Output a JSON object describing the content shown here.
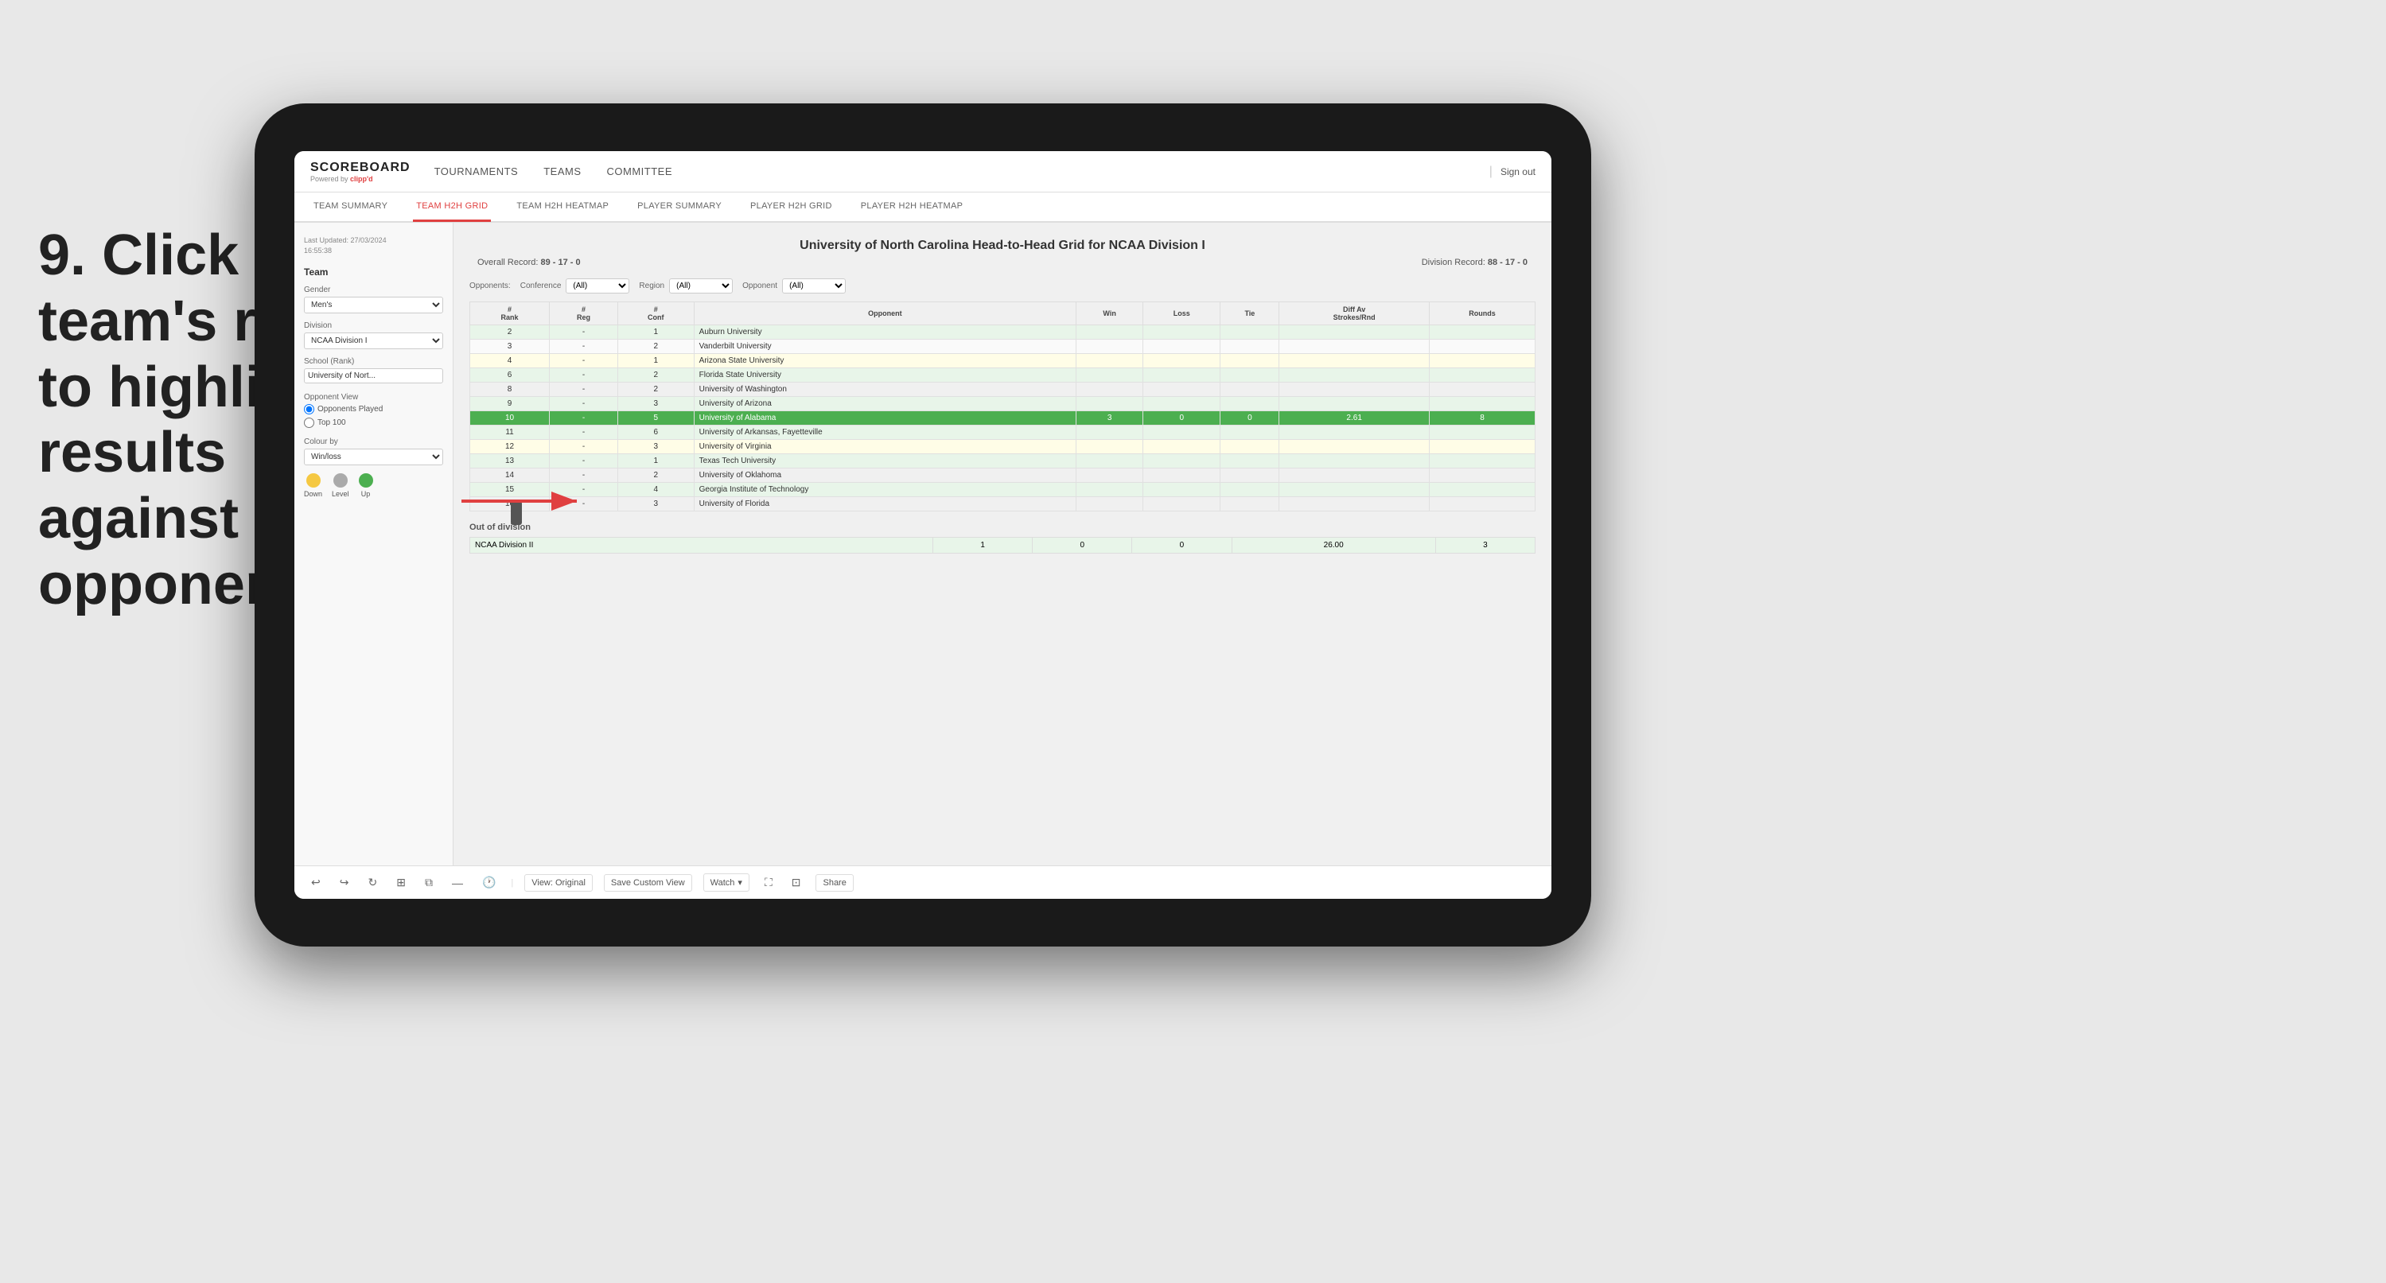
{
  "instruction": {
    "step": "9.",
    "text": "Click on a team's row to highlight results against that opponent"
  },
  "nav": {
    "logo": "SCOREBOARD",
    "powered_by": "Powered by",
    "brand": "clipp'd",
    "items": [
      "TOURNAMENTS",
      "TEAMS",
      "COMMITTEE"
    ],
    "sign_out": "Sign out"
  },
  "sub_nav": {
    "items": [
      "TEAM SUMMARY",
      "TEAM H2H GRID",
      "TEAM H2H HEATMAP",
      "PLAYER SUMMARY",
      "PLAYER H2H GRID",
      "PLAYER H2H HEATMAP"
    ],
    "active": "TEAM H2H GRID"
  },
  "sidebar": {
    "timestamp_label": "Last Updated: 27/03/2024",
    "timestamp_value": "16:55:38",
    "team_label": "Team",
    "gender_label": "Gender",
    "gender_value": "Men's",
    "division_label": "Division",
    "division_value": "NCAA Division I",
    "school_label": "School (Rank)",
    "school_value": "University of Nort...",
    "opponent_view_label": "Opponent View",
    "radio_opponents_played": "Opponents Played",
    "radio_top100": "Top 100",
    "colour_by_label": "Colour by",
    "colour_by_value": "Win/loss",
    "legend": [
      {
        "label": "Down",
        "color": "#f5c842"
      },
      {
        "label": "Level",
        "color": "#aaaaaa"
      },
      {
        "label": "Up",
        "color": "#4caf50"
      }
    ]
  },
  "grid": {
    "title": "University of North Carolina Head-to-Head Grid for NCAA Division I",
    "overall_record_label": "Overall Record:",
    "overall_record": "89 - 17 - 0",
    "division_record_label": "Division Record:",
    "division_record": "88 - 17 - 0",
    "filters": {
      "opponents_label": "Opponents:",
      "conference_label": "Conference",
      "conference_value": "(All)",
      "region_label": "Region",
      "region_value": "(All)",
      "opponent_label": "Opponent",
      "opponent_value": "(All)"
    },
    "columns": [
      "#\nRank",
      "#\nReg",
      "#\nConf",
      "Opponent",
      "Win",
      "Loss",
      "Tie",
      "Diff Av\nStrokes/Rnd",
      "Rounds"
    ],
    "rows": [
      {
        "rank": "2",
        "reg": "-",
        "conf": "1",
        "opponent": "Auburn University",
        "win": "",
        "loss": "",
        "tie": "",
        "diff": "",
        "rounds": "",
        "style": "light-green"
      },
      {
        "rank": "3",
        "reg": "-",
        "conf": "2",
        "opponent": "Vanderbilt University",
        "win": "",
        "loss": "",
        "tie": "",
        "diff": "",
        "rounds": "",
        "style": "normal"
      },
      {
        "rank": "4",
        "reg": "-",
        "conf": "1",
        "opponent": "Arizona State University",
        "win": "",
        "loss": "",
        "tie": "",
        "diff": "",
        "rounds": "",
        "style": "light-yellow"
      },
      {
        "rank": "6",
        "reg": "-",
        "conf": "2",
        "opponent": "Florida State University",
        "win": "",
        "loss": "",
        "tie": "",
        "diff": "",
        "rounds": "",
        "style": "light-green"
      },
      {
        "rank": "8",
        "reg": "-",
        "conf": "2",
        "opponent": "University of Washington",
        "win": "",
        "loss": "",
        "tie": "",
        "diff": "",
        "rounds": "",
        "style": "normal"
      },
      {
        "rank": "9",
        "reg": "-",
        "conf": "3",
        "opponent": "University of Arizona",
        "win": "",
        "loss": "",
        "tie": "",
        "diff": "",
        "rounds": "",
        "style": "light-green"
      },
      {
        "rank": "10",
        "reg": "-",
        "conf": "5",
        "opponent": "University of Alabama",
        "win": "3",
        "loss": "0",
        "tie": "0",
        "diff": "2.61",
        "rounds": "8",
        "style": "highlighted"
      },
      {
        "rank": "11",
        "reg": "-",
        "conf": "6",
        "opponent": "University of Arkansas, Fayetteville",
        "win": "",
        "loss": "",
        "tie": "",
        "diff": "",
        "rounds": "",
        "style": "light-green"
      },
      {
        "rank": "12",
        "reg": "-",
        "conf": "3",
        "opponent": "University of Virginia",
        "win": "",
        "loss": "",
        "tie": "",
        "diff": "",
        "rounds": "",
        "style": "light-yellow"
      },
      {
        "rank": "13",
        "reg": "-",
        "conf": "1",
        "opponent": "Texas Tech University",
        "win": "",
        "loss": "",
        "tie": "",
        "diff": "",
        "rounds": "",
        "style": "light-green"
      },
      {
        "rank": "14",
        "reg": "-",
        "conf": "2",
        "opponent": "University of Oklahoma",
        "win": "",
        "loss": "",
        "tie": "",
        "diff": "",
        "rounds": "",
        "style": "normal"
      },
      {
        "rank": "15",
        "reg": "-",
        "conf": "4",
        "opponent": "Georgia Institute of Technology",
        "win": "",
        "loss": "",
        "tie": "",
        "diff": "",
        "rounds": "",
        "style": "light-green"
      },
      {
        "rank": "16",
        "reg": "-",
        "conf": "3",
        "opponent": "University of Florida",
        "win": "",
        "loss": "",
        "tie": "",
        "diff": "",
        "rounds": "",
        "style": "normal"
      }
    ],
    "out_of_division_label": "Out of division",
    "out_division_row": {
      "label": "NCAA Division II",
      "win": "1",
      "loss": "0",
      "tie": "0",
      "diff": "26.00",
      "rounds": "3"
    }
  },
  "toolbar": {
    "view_original": "View: Original",
    "save_custom_view": "Save Custom View",
    "watch": "Watch",
    "share": "Share"
  }
}
